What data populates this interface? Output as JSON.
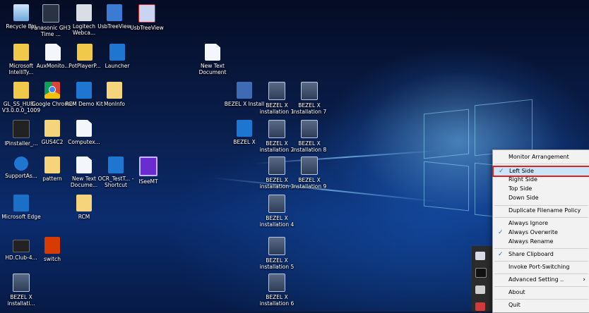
{
  "desktop": {
    "icons": [
      {
        "label": "Recycle Bin",
        "icon": "recycle-bin-icon"
      },
      {
        "label": "Panasonic GH3 Time ...",
        "icon": "camera-icon"
      },
      {
        "label": "Logitech Webca...",
        "icon": "webcam-icon"
      },
      {
        "label": "UsbTreeView",
        "icon": "usb-tree-icon"
      },
      {
        "label": "UsbTreeView",
        "icon": "usb-tree-red-icon"
      },
      {
        "label": "Microsoft IntelliTy...",
        "icon": "folder-icon"
      },
      {
        "label": "AuxMonito...",
        "icon": "document-icon"
      },
      {
        "label": "PotPlayerP...",
        "icon": "folder-icon"
      },
      {
        "label": "Launcher",
        "icon": "launcher-shortcut-icon"
      },
      {
        "label": "New Text Document",
        "icon": "document-icon"
      },
      {
        "label": "GL_SS_HUB... V3.0.0.0_1009",
        "icon": "folder-icon"
      },
      {
        "label": "Google Chrome",
        "icon": "chrome-icon"
      },
      {
        "label": "RCM Demo Kit",
        "icon": "rcm-shortcut-icon"
      },
      {
        "label": "MonInfo",
        "icon": "folder-icon"
      },
      {
        "label": "BEZEL X Install",
        "icon": "installer-icon"
      },
      {
        "label": "BEZEL X installation 1",
        "icon": "bezel-monitor-icon"
      },
      {
        "label": "BEZEL X installation 7",
        "icon": "bezel-monitor-icon"
      },
      {
        "label": "IPinstaller_...",
        "icon": "installer-dark-icon"
      },
      {
        "label": "GUS4C2",
        "icon": "folder-icon"
      },
      {
        "label": "Computex...",
        "icon": "document-icon"
      },
      {
        "label": "BEZEL X",
        "icon": "bezel-shortcut-icon"
      },
      {
        "label": "BEZEL X installation 2",
        "icon": "bezel-monitor-icon"
      },
      {
        "label": "BEZEL X installation 8",
        "icon": "bezel-monitor-icon"
      },
      {
        "label": "SupportAs...",
        "icon": "support-icon"
      },
      {
        "label": "pattern",
        "icon": "folder-icon"
      },
      {
        "label": "New Text Docume...",
        "icon": "document-icon"
      },
      {
        "label": "OCR_TestT... - Shortcut",
        "icon": "ocr-shortcut-icon"
      },
      {
        "label": "ISeeMT",
        "icon": "iseemt-icon"
      },
      {
        "label": "BEZEL X installation 3",
        "icon": "bezel-monitor-icon"
      },
      {
        "label": "BEZEL X installation 9",
        "icon": "bezel-monitor-icon"
      },
      {
        "label": "Microsoft Edge",
        "icon": "edge-icon"
      },
      {
        "label": "RCM",
        "icon": "folder-icon"
      },
      {
        "label": "BEZEL X installation 4",
        "icon": "bezel-monitor-icon"
      },
      {
        "label": "HD.Club-4...",
        "icon": "video-icon"
      },
      {
        "label": "switch",
        "icon": "office-icon"
      },
      {
        "label": "BEZEL X installation 5",
        "icon": "bezel-monitor-icon"
      },
      {
        "label": "BEZEL X installati...",
        "icon": "bezel-monitor-icon"
      },
      {
        "label": "BEZEL X installation 6",
        "icon": "bezel-monitor-icon"
      }
    ]
  },
  "context_menu": {
    "items": [
      {
        "label": "Monitor Arrangement",
        "checked": false
      },
      {
        "label": "Left Side",
        "checked": true,
        "highlighted": true
      },
      {
        "label": "Right Side",
        "checked": false
      },
      {
        "label": "Top Side",
        "checked": false
      },
      {
        "label": "Down Side",
        "checked": false
      },
      {
        "label": "Duplicate Filename Policy",
        "checked": false
      },
      {
        "label": "Always Ignore",
        "checked": false
      },
      {
        "label": "Always Overwrite",
        "checked": true
      },
      {
        "label": "Always Rename",
        "checked": false
      },
      {
        "label": "Share Clipboard",
        "checked": true
      },
      {
        "label": "Invoke Port-Switching",
        "checked": false
      },
      {
        "label": "Advanced Setting ..",
        "checked": false,
        "submenu": true
      },
      {
        "label": "About",
        "checked": false
      },
      {
        "label": "Quit",
        "checked": false
      }
    ],
    "check_glyph": "✓",
    "submenu_glyph": "›"
  },
  "tray_flyout": {
    "icons": [
      "tray-app-icon-1",
      "tray-app-icon-2",
      "tray-app-icon-3",
      "tray-app-icon-4"
    ]
  },
  "colors": {
    "highlight_border": "#e02020",
    "highlight_fill": "#cce4f7",
    "check": "#2b6cc4"
  }
}
